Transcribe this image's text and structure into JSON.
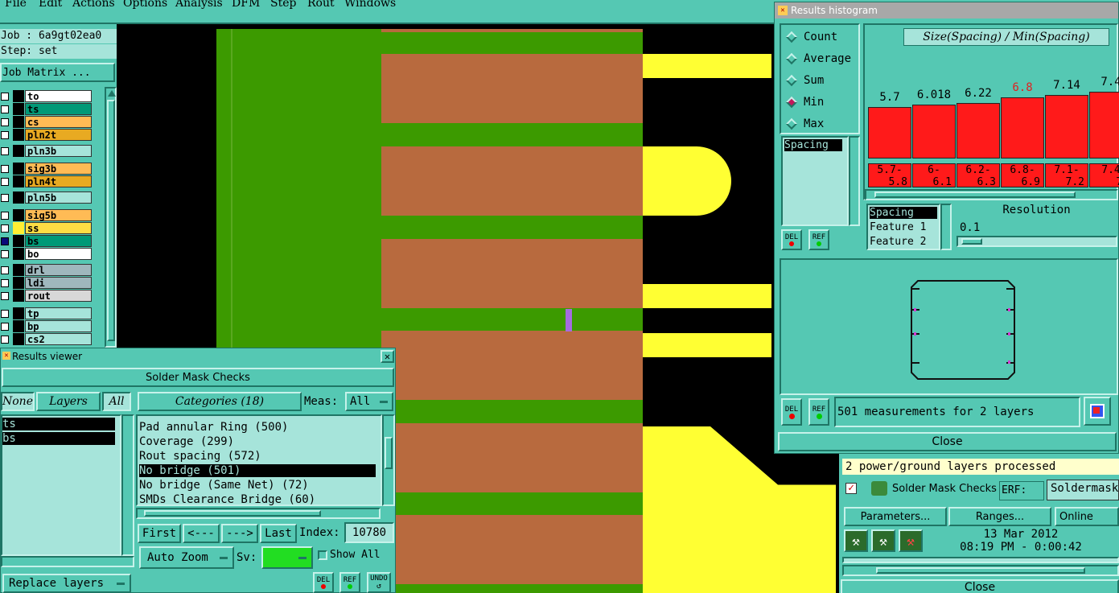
{
  "menu": [
    "File",
    "Edit",
    "Actions",
    "Options",
    "Analysis",
    "DFM",
    "Step",
    "Rout",
    "Windows"
  ],
  "job": {
    "job_label": "Job : 6a9gt02ea0",
    "step_label": "Step: set",
    "matrix_button": "Job Matrix ..."
  },
  "layers": [
    {
      "name": "to",
      "color": "#ffffff"
    },
    {
      "name": "ts",
      "color": "#009977"
    },
    {
      "name": "cs",
      "color": "#ffbb55"
    },
    {
      "name": "pln2t",
      "color": "#e8aa22"
    },
    {
      "name": "pln3b",
      "color": "#a6e4da"
    },
    {
      "name": "sig3b",
      "color": "#ffbb55"
    },
    {
      "name": "pln4t",
      "color": "#e8aa22"
    },
    {
      "name": "pln5b",
      "color": "#a6e4da"
    },
    {
      "name": "sig5b",
      "color": "#ffbb55"
    },
    {
      "name": "ss",
      "color": "#ffdd44"
    },
    {
      "name": "bs",
      "color": "#009977"
    },
    {
      "name": "bo",
      "color": "#ffffff"
    },
    {
      "name": "drl",
      "color": "#9fb7bd"
    },
    {
      "name": "ldi",
      "color": "#9fb7bd"
    },
    {
      "name": "rout",
      "color": "#d8d8d8"
    },
    {
      "name": "tp",
      "color": "#a6e4da"
    },
    {
      "name": "bp",
      "color": "#a6e4da"
    },
    {
      "name": "cs2",
      "color": "#a6e4da"
    }
  ],
  "results_viewer": {
    "title": "Results viewer",
    "header": "Solder Mask Checks",
    "none_btn": "None",
    "layers_btn": "Layers",
    "all_btn": "All",
    "categories_btn": "Categories (18)",
    "meas_label": "Meas:",
    "meas_value": "All",
    "layer_items": [
      "ts",
      "bs"
    ],
    "categories": [
      "Pad annular Ring (500)",
      "Coverage (299)",
      "Rout spacing (572)",
      "No bridge (501)",
      "No bridge (Same Net) (72)",
      "SMDs Clearance Bridge (60)"
    ],
    "selected_category": 3,
    "first_btn": "First",
    "prev_btn": "<---",
    "next_btn": "--->",
    "last_btn": "Last",
    "index_label": "Index:",
    "index_value": "10780",
    "auto_zoom_btn": "Auto Zoom",
    "sv_label": "Sv:",
    "show_all_label": "Show All",
    "replace_btn": "Replace layers",
    "del_label": "DEL",
    "ref_label": "REF",
    "undo_label": "UNDO"
  },
  "histogram": {
    "title": "Results histogram",
    "modes": [
      "Count",
      "Average",
      "Sum",
      "Min",
      "Max"
    ],
    "selected_mode": "Min",
    "chart_title": "Size(Spacing) / Min(Spacing)",
    "bars": [
      {
        "value": "5.7",
        "bin_top": "5.7-",
        "bin_bottom": "5.8",
        "height": 0.58
      },
      {
        "value": "6.018",
        "bin_top": "6-",
        "bin_bottom": "6.1",
        "height": 0.61
      },
      {
        "value": "6.22",
        "bin_top": "6.2-",
        "bin_bottom": "6.3",
        "height": 0.63
      },
      {
        "value": "6.8",
        "bin_top": "6.8-",
        "bin_bottom": "6.9",
        "height": 0.69,
        "highlight": true
      },
      {
        "value": "7.14",
        "bin_top": "7.1-",
        "bin_bottom": "7.2",
        "height": 0.72
      },
      {
        "value": "7.4",
        "bin_top": "7.4",
        "bin_bottom": "7.",
        "height": 0.75
      }
    ],
    "measure_list": [
      "Spacing"
    ],
    "attr_list": [
      "Spacing",
      "Feature 1",
      "Feature 2"
    ],
    "resolution_label": "Resolution",
    "resolution_value": "0.1",
    "summary": "501 measurements for 2 layers",
    "close_label": "Close",
    "del_label": "DEL",
    "ref_label": "REF"
  },
  "checklist": {
    "status": "2 power/ground layers processed",
    "check_name": "Solder Mask Checks",
    "erf_label": "ERF:",
    "erf_value": "Soldermask",
    "params_btn": "Parameters...",
    "ranges_btn": "Ranges...",
    "online_btn": "Online",
    "date": "13 Mar 2012",
    "time": "08:19 PM - 0:00:42",
    "close_label": "Close"
  }
}
